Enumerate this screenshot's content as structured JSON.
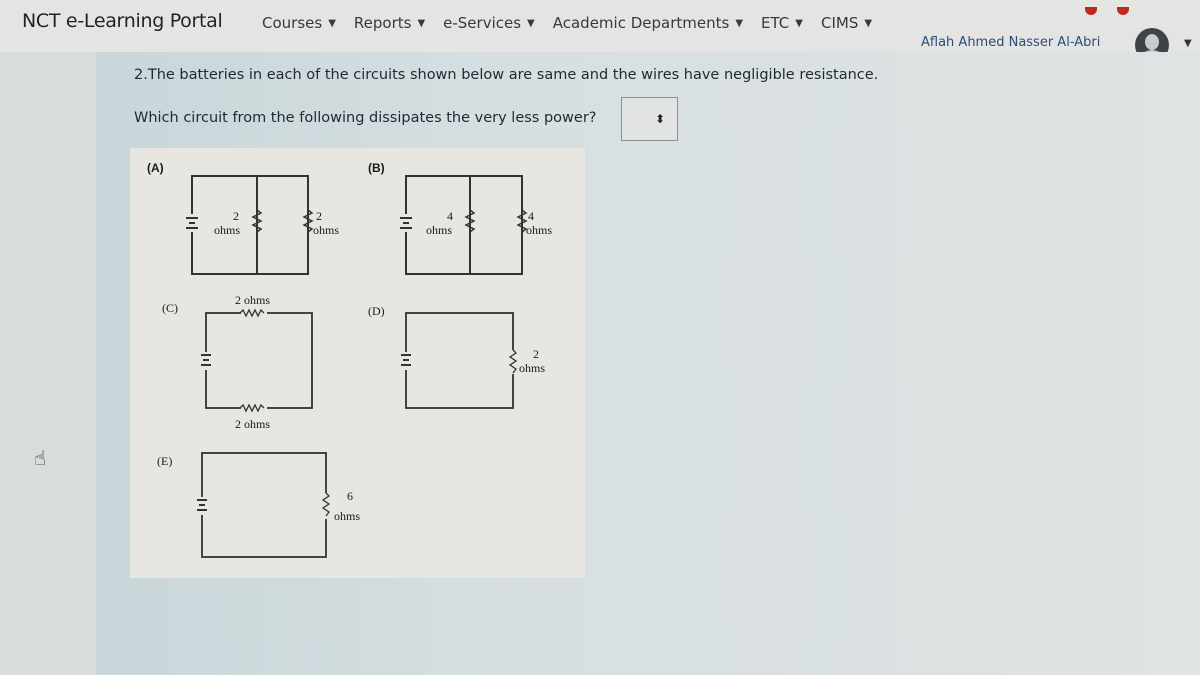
{
  "navbar": {
    "brand": "NCT e-Learning Portal",
    "menu": [
      {
        "label": "Courses",
        "icon": "caret-down"
      },
      {
        "label": "Reports",
        "icon": "caret-down"
      },
      {
        "label": "e-Services",
        "icon": "caret-down"
      },
      {
        "label": "Academic Departments",
        "icon": "caret-down"
      },
      {
        "label": "ETC",
        "icon": "caret-down"
      },
      {
        "label": "CIMS",
        "icon": "caret-down"
      }
    ],
    "user_name": "Aflah Ahmed Nasser Al-Abri",
    "caret_glyph": "▼"
  },
  "question": {
    "line1": "2.The batteries in each of the circuits shown below are same and the wires have negligible resistance.",
    "line2": "Which circuit from the following dissipates the very less power?",
    "select_value": "",
    "select_icon": "⬍"
  },
  "circuits": {
    "A": {
      "label": "(A)",
      "r1_value": "2",
      "r1_unit": "ohms",
      "r2_value": "2",
      "r2_unit": "ohms"
    },
    "B": {
      "label": "(B)",
      "r1_value": "4",
      "r1_unit": "ohms",
      "r2_value": "4",
      "r2_unit": "ohms"
    },
    "C": {
      "label": "(C)",
      "top": "2 ohms",
      "bottom": "2 ohms"
    },
    "D": {
      "label": "(D)",
      "r_value": "2",
      "r_unit": "ohms"
    },
    "E": {
      "label": "(E)",
      "r_value": "6",
      "r_unit": "ohms"
    }
  },
  "cursor_icon": "☝"
}
